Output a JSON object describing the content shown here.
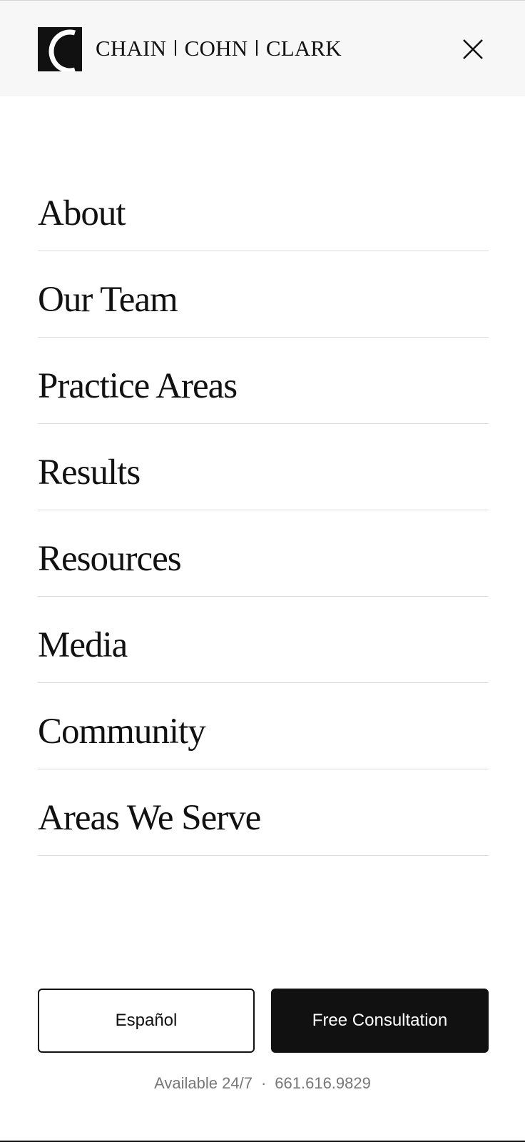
{
  "header": {
    "logo_letter": "C",
    "firm_name_parts": [
      "CHAIN",
      "COHN",
      "CLARK"
    ],
    "close_icon": "close-icon"
  },
  "nav": {
    "items": [
      {
        "label": "About"
      },
      {
        "label": "Our Team"
      },
      {
        "label": "Practice Areas"
      },
      {
        "label": "Results"
      },
      {
        "label": "Resources"
      },
      {
        "label": "Media"
      },
      {
        "label": "Community"
      },
      {
        "label": "Areas We Serve"
      }
    ]
  },
  "actions": {
    "espanol_label": "Español",
    "consult_label": "Free Consultation"
  },
  "footer": {
    "availability": "Available 24/7",
    "separator": "·",
    "phone": "661.616.9829"
  },
  "colors": {
    "header_bg": "#f7f7f7",
    "text": "#111111",
    "divider": "#dcdcdc",
    "muted": "#777777"
  }
}
